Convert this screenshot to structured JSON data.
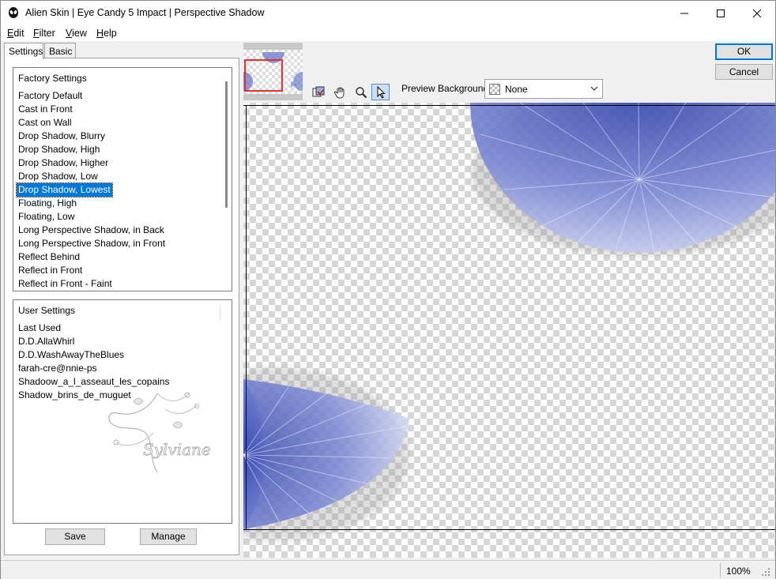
{
  "window": {
    "title": "Alien Skin | Eye Candy 5 Impact | Perspective Shadow",
    "icon": "alien-head-icon"
  },
  "menu": {
    "items": [
      {
        "key": "E",
        "rest": "dit"
      },
      {
        "key": "F",
        "rest": "ilter"
      },
      {
        "key": "V",
        "rest": "iew"
      },
      {
        "key": "H",
        "rest": "elp"
      }
    ]
  },
  "tabs": {
    "settings": "Settings",
    "basic": "Basic"
  },
  "factory": {
    "header": "Factory Settings",
    "items": [
      "Factory Default",
      "Cast in Front",
      "Cast on Wall",
      "Drop Shadow, Blurry",
      "Drop Shadow, High",
      "Drop Shadow, Higher",
      "Drop Shadow, Low",
      "Drop Shadow, Lowest",
      "Floating, High",
      "Floating, Low",
      "Long Perspective Shadow, in Back",
      "Long Perspective Shadow, in Front",
      "Reflect Behind",
      "Reflect in Front",
      "Reflect in Front - Faint"
    ],
    "selected": "Drop Shadow, Lowest"
  },
  "user": {
    "header": "User Settings",
    "items": [
      "Last Used",
      "D.D.AllaWhirl",
      "D.D.WashAwayTheBlues",
      "farah-cre@nnie-ps",
      "Shadoow_a_l_asseaut_les_copains",
      "Shadow_brins_de_muguet"
    ],
    "watermark": "Sylviane"
  },
  "buttons": {
    "save": "Save",
    "manage": "Manage",
    "ok": "OK",
    "cancel": "Cancel"
  },
  "toolbar": {
    "tools": [
      "preview-toggle-icon",
      "hand-icon",
      "zoom-icon",
      "pointer-icon"
    ],
    "active_tool": "pointer-icon"
  },
  "preview_background": {
    "label": "Preview Background:",
    "value": "None"
  },
  "status": {
    "zoom": "100%"
  },
  "colors": {
    "accent": "#0078d7",
    "shape_blue": "#5b6cc8",
    "thumbnail_frame": "#e03030"
  }
}
